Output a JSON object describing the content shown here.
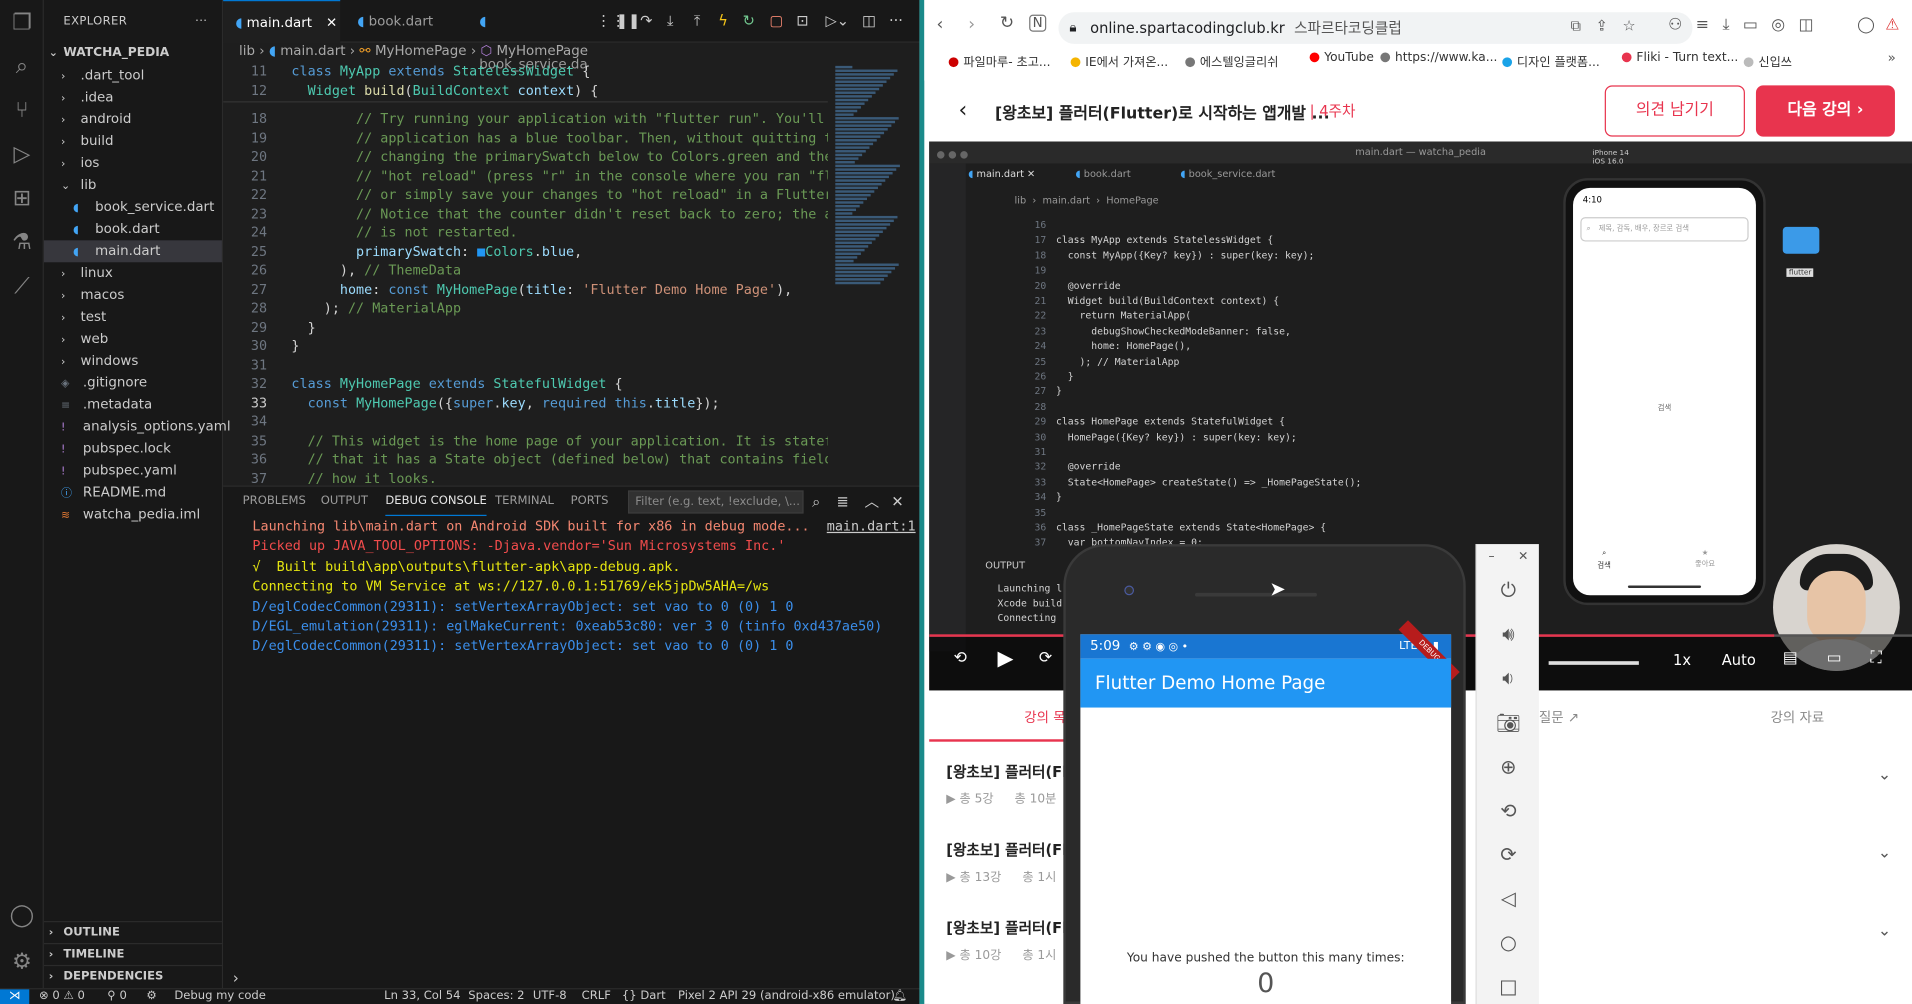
{
  "vscode": {
    "explorer_title": "EXPLORER",
    "more": "···",
    "project": "WATCHA_PEDIA",
    "tree": [
      {
        "label": ".dart_tool",
        "type": "folder",
        "depth": 0
      },
      {
        "label": ".idea",
        "type": "folder",
        "depth": 0
      },
      {
        "label": "android",
        "type": "folder",
        "depth": 0
      },
      {
        "label": "build",
        "type": "folder",
        "depth": 0
      },
      {
        "label": "ios",
        "type": "folder",
        "depth": 0
      },
      {
        "label": "lib",
        "type": "folder-open",
        "depth": 0
      },
      {
        "label": "book_service.dart",
        "type": "dart",
        "depth": 1
      },
      {
        "label": "book.dart",
        "type": "dart",
        "depth": 1
      },
      {
        "label": "main.dart",
        "type": "dart",
        "depth": 1
      },
      {
        "label": "linux",
        "type": "folder",
        "depth": 0
      },
      {
        "label": "macos",
        "type": "folder",
        "depth": 0
      },
      {
        "label": "test",
        "type": "folder",
        "depth": 0
      },
      {
        "label": "web",
        "type": "folder",
        "depth": 0
      },
      {
        "label": "windows",
        "type": "folder",
        "depth": 0
      },
      {
        "label": ".gitignore",
        "type": "git",
        "depth": 0
      },
      {
        "label": ".metadata",
        "type": "meta",
        "depth": 0
      },
      {
        "label": "analysis_options.yaml",
        "type": "yaml",
        "depth": 0
      },
      {
        "label": "pubspec.lock",
        "type": "yaml",
        "depth": 0
      },
      {
        "label": "pubspec.yaml",
        "type": "yaml",
        "depth": 0
      },
      {
        "label": "README.md",
        "type": "info",
        "depth": 0
      },
      {
        "label": "watcha_pedia.iml",
        "type": "xml",
        "depth": 0
      }
    ],
    "sections": [
      "OUTLINE",
      "TIMELINE",
      "DEPENDENCIES"
    ],
    "tabs": [
      "main.dart",
      "book.dart",
      "book_service.da"
    ],
    "breadcrumb": [
      "lib",
      "main.dart",
      "MyHomePage",
      "MyHomePage"
    ],
    "code_lines": [
      {
        "n": "11",
        "html": "<span class='k'>class</span> <span class='t'>MyApp</span> <span class='k'>extends</span> <span class='t'>StatelessWidget</span> {"
      },
      {
        "n": "12",
        "html": "  <span class='t'>Widget</span> <span class='f'>build</span>(<span class='t'>BuildContext</span> <span class='p'>context</span>) {"
      },
      {
        "n": "18",
        "html": "        <span class='c'>// Try running your application with \"flutter run\". You'll see</span>"
      },
      {
        "n": "19",
        "html": "        <span class='c'>// application has a blue toolbar. Then, without quitting the</span>"
      },
      {
        "n": "20",
        "html": "        <span class='c'>// changing the primarySwatch below to Colors.green and then i</span>"
      },
      {
        "n": "21",
        "html": "        <span class='c'>// \"hot reload\" (press \"r\" in the console where you ran \"flutt</span>"
      },
      {
        "n": "22",
        "html": "        <span class='c'>// or simply save your changes to \"hot reload\" in a Flutter ID</span>"
      },
      {
        "n": "23",
        "html": "        <span class='c'>// Notice that the counter didn't reset back to zero; the appl</span>"
      },
      {
        "n": "24",
        "html": "        <span class='c'>// is not restarted.</span>"
      },
      {
        "n": "25",
        "html": "        <span class='p'>primarySwatch</span>: <span style='color:#2196f3'>■</span><span class='t'>Colors</span>.<span class='p'>blue</span>,"
      },
      {
        "n": "26",
        "html": "      ), <span class='c'>// ThemeData</span>"
      },
      {
        "n": "27",
        "html": "      <span class='p'>home</span>: <span class='k'>const</span> <span class='t'>MyHomePage</span>(<span class='p'>title</span>: <span class='s'>'Flutter Demo Home Page'</span>),"
      },
      {
        "n": "28",
        "html": "    ); <span class='c'>// MaterialApp</span>"
      },
      {
        "n": "29",
        "html": "  }"
      },
      {
        "n": "30",
        "html": "}"
      },
      {
        "n": "31",
        "html": ""
      },
      {
        "n": "32",
        "html": "<span class='k'>class</span> <span class='t'>MyHomePage</span> <span class='k'>extends</span> <span class='t'>StatefulWidget</span> {"
      },
      {
        "n": "33",
        "html": "  <span class='k'>const</span> <span class='t'>MyHomePage</span>({<span class='k'>super</span>.<span class='p'>key</span>, <span class='k'>required</span> <span class='k'>this</span>.<span class='p'>title</span>});"
      },
      {
        "n": "34",
        "html": ""
      },
      {
        "n": "35",
        "html": "  <span class='c'>// This widget is the home page of your application. It is stateful,</span>"
      },
      {
        "n": "36",
        "html": "  <span class='c'>// that it has a State object (defined below) that contains fields t</span>"
      },
      {
        "n": "37",
        "html": "  <span class='c'>// how it looks.</span>"
      }
    ],
    "panel_tabs": [
      "PROBLEMS",
      "OUTPUT",
      "DEBUG CONSOLE",
      "TERMINAL",
      "PORTS"
    ],
    "filter_placeholder": "Filter (e.g. text, !exclude, \\...",
    "console_link": "main.dart:1",
    "console": [
      {
        "text": "Launching lib\\main.dart on Android SDK built for x86 in debug mode...",
        "color": "#f48771"
      },
      {
        "text": "Picked up JAVA_TOOL_OPTIONS: -Djava.vendor='Sun Microsystems Inc.'",
        "color": "#f14c4c"
      },
      {
        "text": "√  Built build\\app\\outputs\\flutter-apk\\app-debug.apk.",
        "color": "#e5e510"
      },
      {
        "text": "Connecting to VM Service at ws://127.0.0.1:51769/ek5jpDw5AHA=/ws",
        "color": "#e5e510"
      },
      {
        "text": "D/eglCodecCommon(29311): setVertexArrayObject: set vao to 0 (0) 1 0",
        "color": "#3b8eea"
      },
      {
        "text": "D/EGL_emulation(29311): eglMakeCurrent: 0xeab53c80: ver 3 0 (tinfo 0xd437ae50)",
        "color": "#3b8eea"
      },
      {
        "text": "D/eglCodecCommon(29311): setVertexArrayObject: set vao to 0 (0) 1 0",
        "color": "#3b8eea"
      }
    ],
    "status": {
      "errors": "⊗ 0 ⚠ 0",
      "ports": "⚲ 0",
      "debug": "Debug my code",
      "position": "Ln 33, Col 54",
      "spaces": "Spaces: 2",
      "encoding": "UTF-8",
      "eol": "CRLF",
      "lang": "{} Dart",
      "device": "Pixel 2 API 29 (android-x86 emulator)"
    }
  },
  "browser": {
    "url": "online.spartacodingclub.kr",
    "site_name": "스파르타코딩클럽",
    "bookmarks": [
      {
        "label": "파일마루- 초고...",
        "color": "#c00"
      },
      {
        "label": "IE에서 가져온...",
        "color": "#f5b400"
      },
      {
        "label": "에스텔잉글리쉬",
        "color": "#777"
      },
      {
        "label": "YouTube",
        "color": "#f00"
      },
      {
        "label": "https://www.ka...",
        "color": "#777"
      },
      {
        "label": "디자인 플랫폼...",
        "color": "#1aa3e8"
      },
      {
        "label": "Fliki - Turn text...",
        "color": "#e8344e"
      },
      {
        "label": "신입쓰",
        "color": "#bbb"
      }
    ],
    "lecture_title": "[왕초보] 플러터(Flutter)로 시작하는 앱개발 ...",
    "week": "4주차",
    "feedback_btn": "의견 남기기",
    "next_btn": "다음 강의 ›",
    "video": {
      "title": "main.dart — watcha_pedia",
      "tabs": [
        "main.dart",
        "book.dart",
        "book_service.dart"
      ],
      "crumb": "lib  ›  main.dart  ›  HomePage",
      "lines": [
        {
          "n": "16",
          "t": ""
        },
        {
          "n": "17",
          "t": "class MyApp extends StatelessWidget {"
        },
        {
          "n": "18",
          "t": "  const MyApp({Key? key}) : super(key: key);"
        },
        {
          "n": "19",
          "t": ""
        },
        {
          "n": "20",
          "t": "  @override"
        },
        {
          "n": "21",
          "t": "  Widget build(BuildContext context) {"
        },
        {
          "n": "22",
          "t": "    return MaterialApp("
        },
        {
          "n": "23",
          "t": "      debugShowCheckedModeBanner: false,"
        },
        {
          "n": "24",
          "t": "      home: HomePage(),"
        },
        {
          "n": "25",
          "t": "    ); // MaterialApp"
        },
        {
          "n": "26",
          "t": "  }"
        },
        {
          "n": "27",
          "t": "}"
        },
        {
          "n": "28",
          "t": ""
        },
        {
          "n": "29",
          "t": "class HomePage extends StatefulWidget {"
        },
        {
          "n": "30",
          "t": "  HomePage({Key? key}) : super(key: key);"
        },
        {
          "n": "31",
          "t": ""
        },
        {
          "n": "32",
          "t": "  @override"
        },
        {
          "n": "33",
          "t": "  State<HomePage> createState() => _HomePageState();"
        },
        {
          "n": "34",
          "t": "}"
        },
        {
          "n": "35",
          "t": ""
        },
        {
          "n": "36",
          "t": "class _HomePageState extends State<HomePage> {"
        },
        {
          "n": "37",
          "t": "  var bottomNavIndex = 0;"
        }
      ],
      "panel_tab": "OUTPUT",
      "panel_lines": [
        "Launching l",
        "Xcode build",
        "Connecting"
      ],
      "device_name": "iPhone 14",
      "device_os": "iOS 16.0",
      "time": "4:10",
      "search_hint": "제목, 감독, 배우, 장르로 검색",
      "center_label": "검색",
      "nav1": "검색",
      "nav2": "좋아요",
      "folder": "flutter",
      "speed": "1x",
      "quality": "Auto"
    },
    "list_tab1": "강의 목차",
    "list_tab2": "질문 ↗",
    "list_tab3": "강의 자료",
    "lessons": [
      {
        "title": "[왕초보] 플러터(Flut",
        "count": "총 5강",
        "time": "총 10분"
      },
      {
        "title": "[왕초보] 플러터(Flut",
        "count": "총 13강",
        "time": "총 1시"
      },
      {
        "title": "[왕초보] 플러터(Flut",
        "count": "총 10강",
        "time": "총 1시"
      }
    ]
  },
  "emulator": {
    "time": "5:09",
    "status_icons": "⚙ ⚙ ◉ ◎ •",
    "signal": "LTE ◢ ▮",
    "debug_ribbon": "DEBUG",
    "appbar_title": "Flutter Demo Home Page",
    "counter_label": "You have pushed the button this many times:",
    "counter": "0"
  }
}
